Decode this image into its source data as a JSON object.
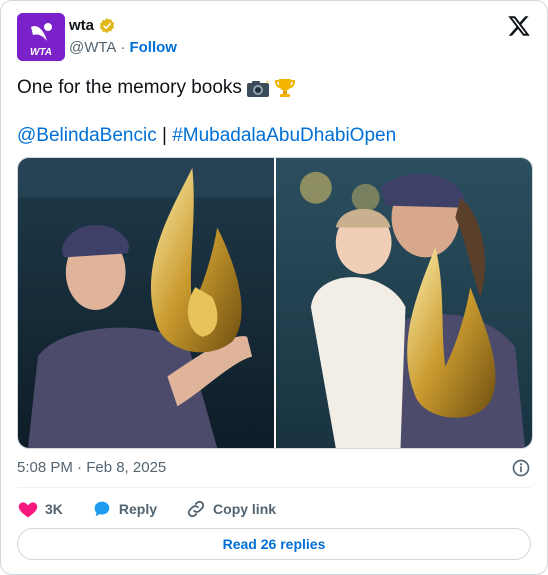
{
  "author": {
    "display_name": "wta",
    "handle": "@WTA",
    "separator": "·",
    "follow_label": "Follow",
    "avatar_text": "WTA",
    "avatar_color": "#7a21c9",
    "verified_color": "#e2b719"
  },
  "tweet": {
    "line1_text": "One for the memory books",
    "line1_emoji": [
      "camera-flash-emoji",
      "trophy-emoji"
    ],
    "mention": "@BelindaBencic",
    "pipe": "|",
    "hashtag": "#MubadalaAbuDhabiOpen",
    "timestamp": "5:08 PM · Feb 8, 2025"
  },
  "media": [
    {
      "name": "photo-left",
      "description_icon": "photo"
    },
    {
      "name": "photo-right",
      "description_icon": "photo"
    }
  ],
  "actions": {
    "like_count": "3K",
    "reply_label": "Reply",
    "copy_label": "Copy link",
    "like_color": "#f91880",
    "reply_color": "#1d9bf0"
  },
  "read_replies_label": "Read 26 replies",
  "colors": {
    "link": "#006fd6",
    "secondary_text": "#536471",
    "border": "#cfd9de"
  }
}
